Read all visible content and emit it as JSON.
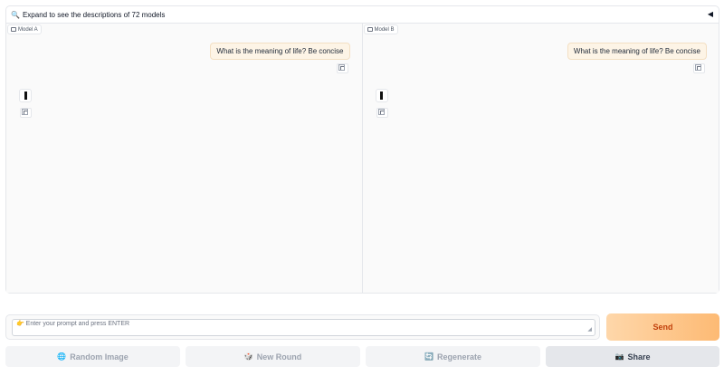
{
  "accordion": {
    "icon": "magnifier-icon",
    "label": "Expand to see the descriptions of 72 models",
    "caret": "◀"
  },
  "panels": [
    {
      "model_label": "Model A",
      "user_message": "What is the meaning of life? Be concise"
    },
    {
      "model_label": "Model B",
      "user_message": "What is the meaning of life? Be concise"
    }
  ],
  "input": {
    "placeholder": "👉 Enter your prompt and press ENTER",
    "value": ""
  },
  "send_button": {
    "label": "Send",
    "colors": {
      "bg_start": "#fed7aa",
      "bg_end": "#fdba74",
      "text": "#c2410c"
    }
  },
  "actions": [
    {
      "icon": "🌐",
      "label": "Random Image"
    },
    {
      "icon": "🎲",
      "label": "New Round"
    },
    {
      "icon": "🔄",
      "label": "Regenerate"
    },
    {
      "icon": "📷",
      "label": "Share"
    }
  ]
}
